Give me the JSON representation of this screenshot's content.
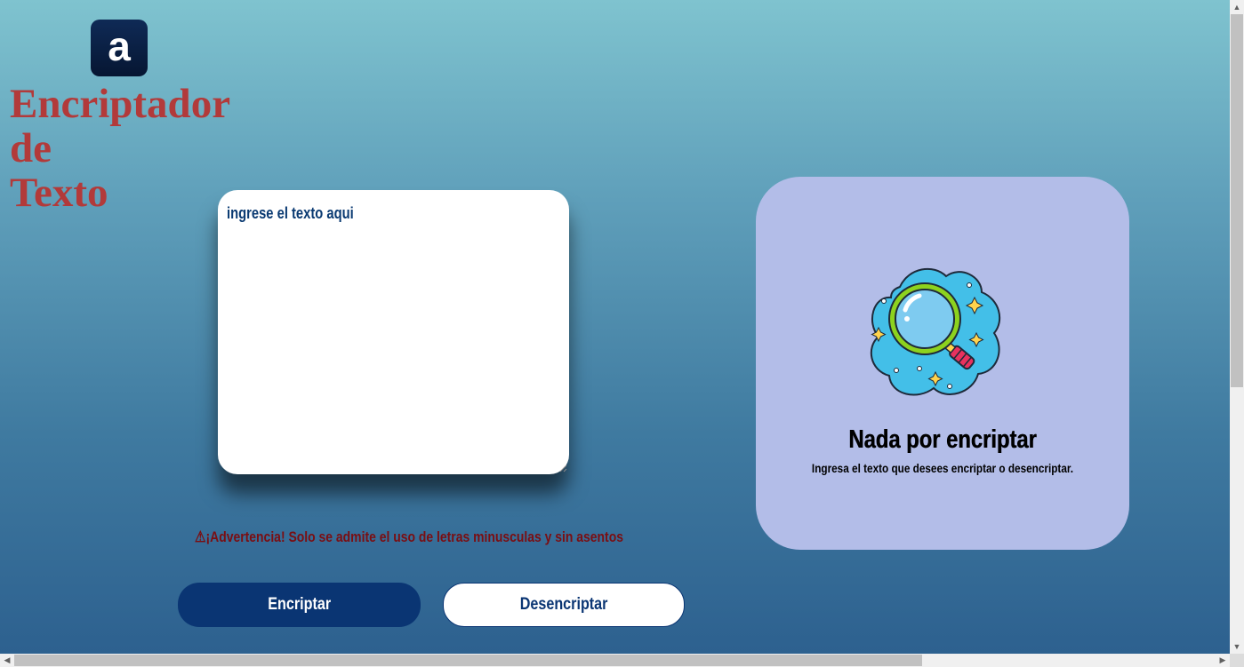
{
  "header": {
    "logo_letter": "a",
    "title_lines": [
      "Encriptador",
      "de",
      "Texto"
    ]
  },
  "input": {
    "placeholder": "ingrese el texto aqui"
  },
  "warning": {
    "icon": "warning-triangle-icon",
    "text": "⚠¡Advertencia! Solo se admite el uso de letras minusculas y sin asentos"
  },
  "buttons": {
    "encrypt_label": "Encriptar",
    "decrypt_label": "Desencriptar"
  },
  "output_panel": {
    "image": "magnifying-glass-illustration",
    "title": "Nada por encriptar",
    "subtitle": "Ingresa el texto que desees encriptar o desencriptar."
  },
  "colors": {
    "title": "#b23a3a",
    "primary_button": "#0a3573",
    "panel_background": "#b3bde8",
    "warning_text": "#7a0e12"
  }
}
